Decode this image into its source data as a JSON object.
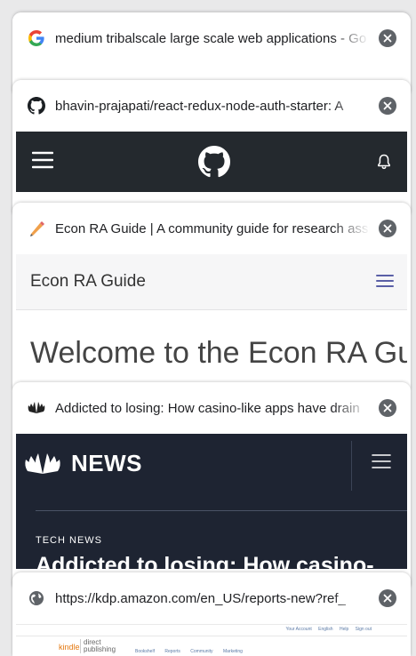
{
  "tabs": [
    {
      "title": "medium tribalscale large scale web applications - Go",
      "favicon": "google-icon"
    },
    {
      "title": "bhavin-prajapati/react-redux-node-auth-starter: A",
      "favicon": "github-icon"
    },
    {
      "title": "Econ RA Guide | A community guide for research assi",
      "favicon": "pencil-icon"
    },
    {
      "title": "Addicted to losing: How casino-like apps have drain",
      "favicon": "nbc-peacock-icon"
    },
    {
      "title": "https://kdp.amazon.com/en_US/reports-new?ref_",
      "favicon": "globe-icon"
    }
  ],
  "econ": {
    "site_title": "Econ RA Guide",
    "heading": "Welcome to the Econ RA Guide!"
  },
  "nbc": {
    "logo_text": "NEWS",
    "section": "TECH NEWS",
    "headline": "Addicted to losing: How casino-"
  },
  "kdp": {
    "top_links": [
      "Your Account",
      "English",
      "Help",
      "Sign out"
    ],
    "logo_kindle": "kindle",
    "logo_direct": "direct",
    "logo_publishing": "publishing",
    "nav": [
      "Bookshelf",
      "Reports",
      "Community",
      "Marketing"
    ]
  },
  "colors": {
    "github_bar": "#24292e",
    "nbc_bar": "#1e2432",
    "econ_menu": "#5a5fa6",
    "close_button": "#5f6368"
  }
}
